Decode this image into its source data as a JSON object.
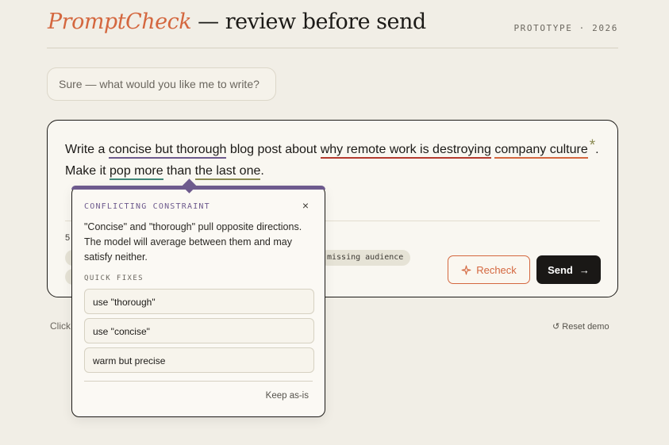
{
  "header": {
    "brand": "PromptCheck",
    "title_rest": " — review before send",
    "tagline": "PROTOTYPE · 2026"
  },
  "assistant_message": "Sure — what would you like me to write?",
  "composer": {
    "segments": {
      "s1": "Write a ",
      "h1": "concise but thorough",
      "s2": " blog post about ",
      "h2": "why remote work is destroying",
      "s3": " ",
      "h3": "company culture",
      "marker": "*",
      "s4": ". Make it ",
      "h4": "pop more",
      "s5": " than ",
      "h5": "the last one",
      "s6": "."
    },
    "issue_count": "5",
    "chip_missing_audience": "missing audience",
    "recheck_label": "Recheck",
    "send_label": "Send",
    "send_arrow": "→"
  },
  "footer": {
    "hint": "Click",
    "reset": "↺ Reset demo"
  },
  "popover": {
    "heading": "CONFLICTING CONSTRAINT",
    "close": "×",
    "description": "\"Concise\" and \"thorough\" pull opposite directions. The model will average between them and may satisfy neither.",
    "fixes_heading": "QUICK FIXES",
    "fixes": [
      "use \"thorough\"",
      "use \"concise\"",
      "warm but precise"
    ],
    "keep": "Keep as-is"
  },
  "icons": {
    "recheck": "sparkle-icon",
    "send": "arrow-right-icon",
    "close": "close-icon",
    "reset": "reset-icon"
  },
  "colors": {
    "brand": "#d4673f",
    "conflict": "#6d5a8d",
    "vague": "#b33a2e",
    "teal": "#3f8778",
    "olive": "#8a8a52",
    "dark": "#1a1816",
    "background": "#f1eee6"
  }
}
